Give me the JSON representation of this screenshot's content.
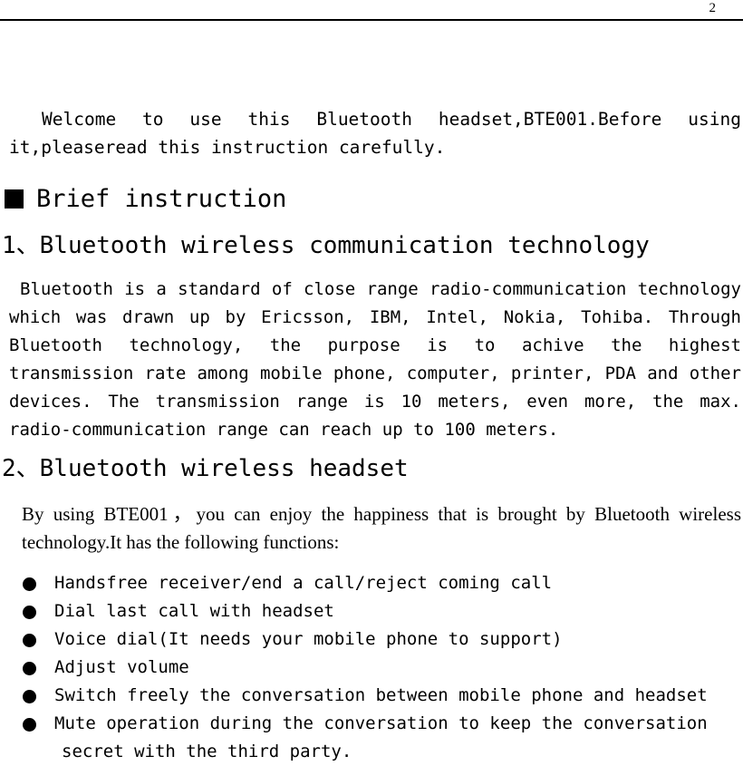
{
  "header": {
    "page_number": "2"
  },
  "intro": {
    "text": "Welcome  to  use  this  Bluetooth  headset,BTE001.Before  using it,pleaseread this instruction carefully."
  },
  "section": {
    "bullet_icon": "filled-square-bullet",
    "title": "Brief instruction"
  },
  "subsections": [
    {
      "title": "1、Bluetooth wireless communication technology",
      "paragraph": "Bluetooth is a standard of close range radio-communication technology which was drawn up by Ericsson, IBM, Intel, Nokia, Tohiba. Through Bluetooth technology, the purpose is to achive the highest transmission rate among mobile phone, computer, printer, PDA and other devices. The transmission range is 10 meters, even more, the max. radio-communication range can reach up to 100 meters."
    },
    {
      "title": "2、Bluetooth wireless headset",
      "paragraph": "By using BTE001，you can enjoy the happiness that is brought by Bluetooth wireless technology.It has the following functions:"
    }
  ],
  "features": {
    "bullet_icon": "filled-circle-bullet",
    "items": [
      "Handsfree receiver/end a call/reject coming call",
      "Dial last call with headset",
      "Voice dial(It needs your mobile phone to support)",
      "Adjust volume",
      "Switch freely the conversation between mobile phone and headset",
      "Mute operation during the conversation to keep the conversation secret with the third party."
    ]
  },
  "colors": {
    "text": "#000000",
    "background": "#ffffff",
    "rule": "#000000"
  }
}
